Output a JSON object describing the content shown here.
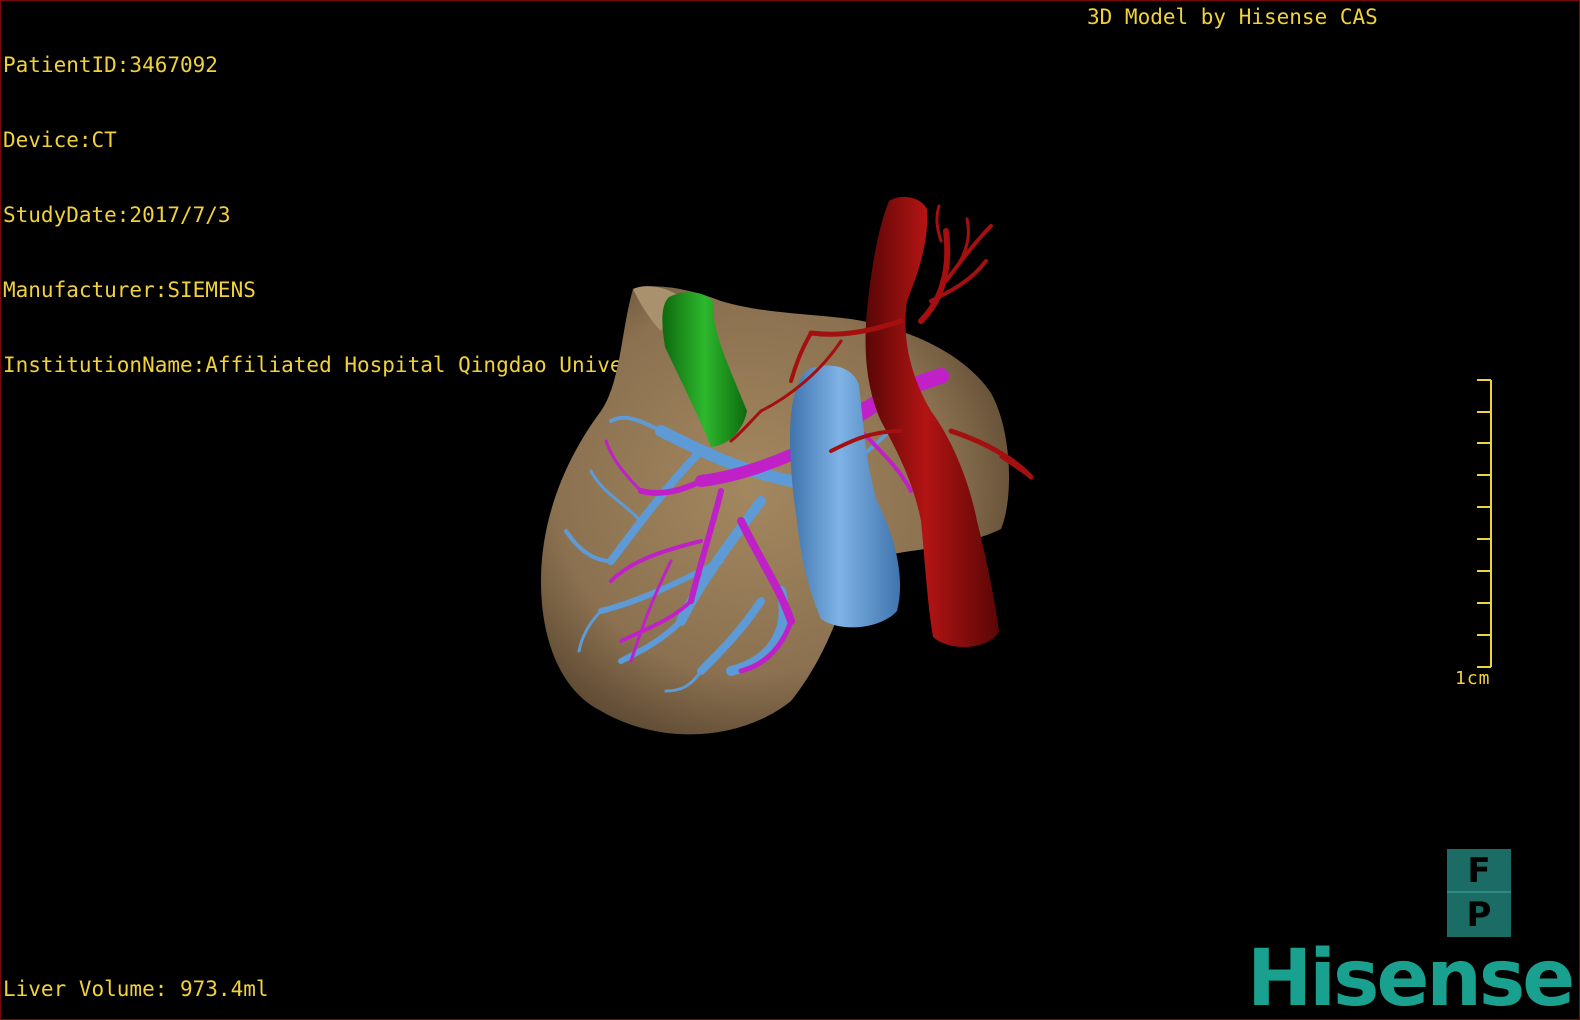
{
  "patient_info": {
    "patient_id": "PatientID:3467092",
    "device": "Device:CT",
    "study_date": "StudyDate:2017/7/3",
    "manufacturer": "Manufacturer:SIEMENS",
    "institution": "InstitutionName:Affiliated Hospital Qingdao University-C"
  },
  "credit": "3D Model by Hisense CAS",
  "liver_volume": "Liver Volume: 973.4ml",
  "scale": {
    "label": "1cm"
  },
  "orientation": {
    "top": "F",
    "bottom": "P"
  },
  "logo": "Hisense",
  "colors": {
    "overlay_text": "#f2d23a",
    "liver": "#8b7150",
    "portal_vein": "#c020c8",
    "hepatic_vein": "#5d9ad6",
    "inferior_vena_cava": "#5d9ad6",
    "aorta": "#9a0f0f",
    "gallbladder": "#1f9a1f",
    "logo": "#19a08e",
    "orientation_box": "#1c6c66"
  }
}
